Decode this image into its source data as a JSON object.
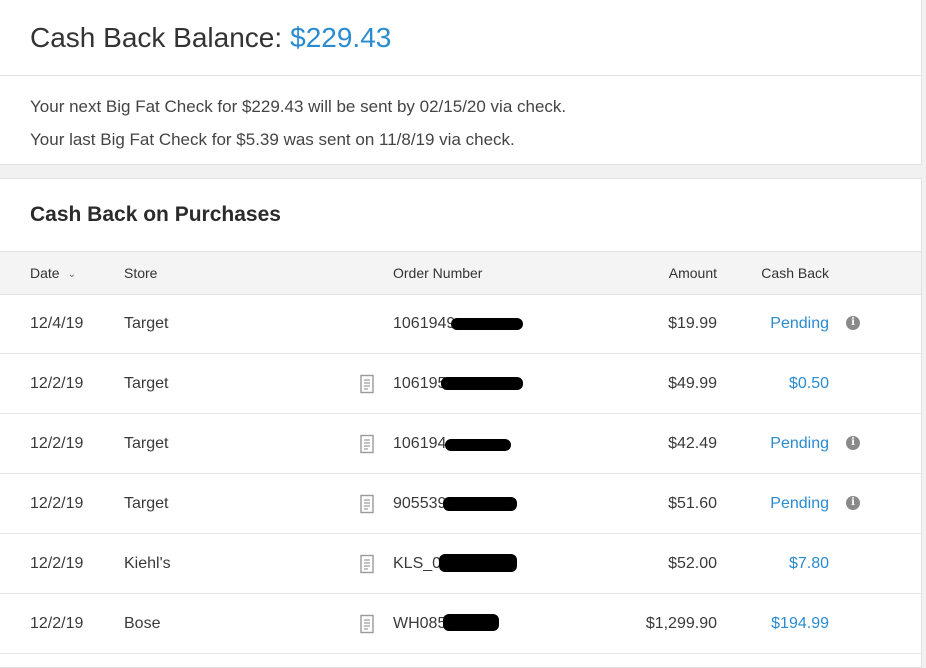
{
  "balance": {
    "label": "Cash Back Balance:",
    "amount": "$229.43",
    "next_check": "Your next Big Fat Check for $229.43 will be sent by 02/15/20 via check.",
    "last_check": "Your last Big Fat Check for $5.39 was sent on 11/8/19 via check."
  },
  "purchases": {
    "title": "Cash Back on Purchases",
    "columns": {
      "date": "Date",
      "store": "Store",
      "order": "Order Number",
      "amount": "Amount",
      "cashback": "Cash Back"
    },
    "rows": [
      {
        "date": "12/4/19",
        "store": "Target",
        "order": "1061949",
        "amount": "$19.99",
        "cashback": "Pending"
      },
      {
        "date": "12/2/19",
        "store": "Target",
        "order": "106195",
        "amount": "$49.99",
        "cashback": "$0.50"
      },
      {
        "date": "12/2/19",
        "store": "Target",
        "order": "106194",
        "amount": "$42.49",
        "cashback": "Pending"
      },
      {
        "date": "12/2/19",
        "store": "Target",
        "order": "905539",
        "amount": "$51.60",
        "cashback": "Pending"
      },
      {
        "date": "12/2/19",
        "store": "Kiehl's",
        "order": "KLS_0",
        "amount": "$52.00",
        "cashback": "$7.80"
      },
      {
        "date": "12/2/19",
        "store": "Bose",
        "order": "WH085",
        "amount": "$1,299.90",
        "cashback": "$194.99"
      }
    ]
  },
  "colors": {
    "accent": "#2a8bd0",
    "icon_gray": "#8a8a8a"
  },
  "icons": {
    "sort": "chevron-down-icon",
    "receipt": "receipt-icon",
    "info": "info-icon"
  }
}
